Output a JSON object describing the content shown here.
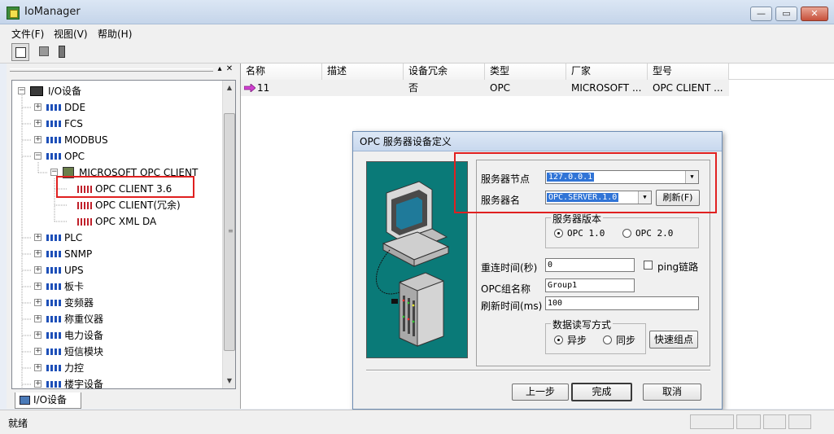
{
  "window": {
    "title": "IoManager"
  },
  "menu": [
    "文件(F)",
    "视图(V)",
    "帮助(H)"
  ],
  "tree": {
    "root": "I/O设备",
    "items": [
      {
        "label": "DDE"
      },
      {
        "label": "FCS"
      },
      {
        "label": "MODBUS"
      },
      {
        "label": "OPC"
      },
      {
        "label": "MICROSOFT OPC CLIENT"
      },
      {
        "label": "OPC CLIENT 3.6"
      },
      {
        "label": "OPC CLIENT(冗余)"
      },
      {
        "label": "OPC XML DA"
      },
      {
        "label": "PLC"
      },
      {
        "label": "SNMP"
      },
      {
        "label": "UPS"
      },
      {
        "label": "板卡"
      },
      {
        "label": "变频器"
      },
      {
        "label": "称重仪器"
      },
      {
        "label": "电力设备"
      },
      {
        "label": "短信模块"
      },
      {
        "label": "力控"
      },
      {
        "label": "楼宇设备"
      }
    ],
    "bottom_tab": "I/O设备"
  },
  "grid": {
    "columns": [
      "名称",
      "描述",
      "设备冗余",
      "类型",
      "厂家",
      "型号"
    ],
    "rows": [
      {
        "name": "11",
        "desc": "",
        "redundant": "否",
        "type": "OPC",
        "vendor": "MICROSOFT ...",
        "model": "OPC CLIENT ..."
      }
    ]
  },
  "dialog": {
    "title": "OPC 服务器设备定义",
    "server_node_label": "服务器节点",
    "server_node_value": "127.0.0.1",
    "server_name_label": "服务器名",
    "server_name_value": "OPC.SERVER.1.0",
    "refresh_button": "刷新(F)",
    "version_group": "服务器版本",
    "version_opc1": "OPC 1.0",
    "version_opc2": "OPC 2.0",
    "reconnect_label": "重连时间(秒)",
    "reconnect_value": "0",
    "ping_label": "ping链路",
    "group_name_label": "OPC组名称",
    "group_name_value": "Group1",
    "refresh_time_label": "刷新时间(ms)",
    "refresh_time_value": "100",
    "rw_group": "数据读写方式",
    "async_label": "异步",
    "sync_label": "同步",
    "quick_group_button": "快速组点",
    "prev_button": "上一步",
    "finish_button": "完成",
    "cancel_button": "取消"
  },
  "status": {
    "text": "就绪"
  },
  "colors": {
    "highlight": "#e02020",
    "selection": "#3074d6",
    "teal": "#0a7a78"
  }
}
